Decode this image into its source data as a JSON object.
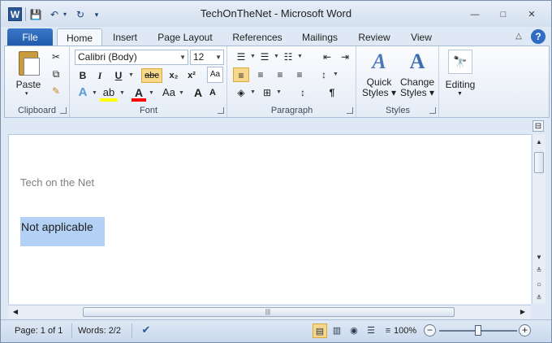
{
  "window": {
    "title": "TechOnTheNet - Microsoft Word",
    "app_icon": "W"
  },
  "quick_access": {
    "save_icon": "💾",
    "undo_icon": "↶",
    "dropdown_icon": "▾",
    "redo_icon": "↻",
    "customize_icon": "▾"
  },
  "window_controls": {
    "minimize": "—",
    "maximize": "□",
    "close": "✕"
  },
  "tabs": {
    "file": "File",
    "home": "Home",
    "insert": "Insert",
    "page_layout": "Page Layout",
    "references": "References",
    "mailings": "Mailings",
    "review": "Review",
    "view": "View",
    "collapse_icon": "△",
    "help_icon": "?"
  },
  "clipboard": {
    "label": "Clipboard",
    "paste": "Paste",
    "cut_icon": "✂",
    "copy_icon": "⧉",
    "format_painter_icon": "✎"
  },
  "font": {
    "label": "Font",
    "name": "Calibri (Body)",
    "size": "12",
    "bold": "B",
    "italic": "I",
    "underline": "U",
    "strikethrough": "abc",
    "subscript": "x₂",
    "superscript": "x²",
    "clear_format": "Aa",
    "text_effects": "A",
    "highlight": "ab",
    "font_color": "A",
    "change_case": "Aa",
    "grow_font": "A",
    "shrink_font": "A"
  },
  "paragraph": {
    "label": "Paragraph",
    "bullets": "☰",
    "numbering": "☰",
    "multilevel": "☷",
    "decrease_indent": "⇤",
    "increase_indent": "⇥",
    "align_left": "≡",
    "align_center": "≡",
    "align_right": "≡",
    "justify": "≡",
    "line_spacing": "↕",
    "shading": "◈",
    "borders": "⊞",
    "sort": "↕",
    "show_marks": "¶"
  },
  "styles": {
    "label": "Styles",
    "quick_styles_line1": "Quick",
    "quick_styles_line2": "Styles ▾",
    "change_styles_line1": "Change",
    "change_styles_line2": "Styles ▾",
    "big_glyph": "A"
  },
  "editing": {
    "label": "Editing",
    "icon": "🔭"
  },
  "document": {
    "heading": "Tech on the Net",
    "selected_text": "Not applicable"
  },
  "scrollbar": {
    "up": "▲",
    "down": "▼",
    "left": "◀",
    "right": "▶",
    "grip": "|||",
    "prev_page": "≛",
    "browse_object": "○",
    "next_page": "≚",
    "ruler_toggle": "⊟"
  },
  "status": {
    "page": "Page: 1 of 1",
    "words": "Words: 2/2",
    "proofing_icon": "✔",
    "view_print": "▤",
    "view_fullscreen": "▥",
    "view_web": "◉",
    "view_outline": "☰",
    "view_draft": "≡",
    "zoom": "100%",
    "zoom_out": "−",
    "zoom_in": "+",
    "zoom_fraction": 0.5
  }
}
